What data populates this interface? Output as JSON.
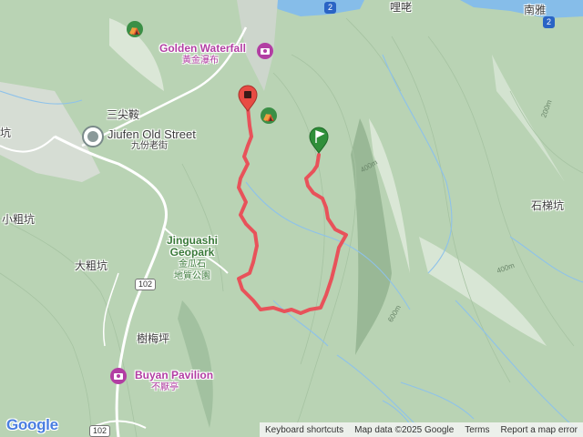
{
  "places": {
    "golden_waterfall": {
      "en": "Golden Waterfall",
      "zh": "黃金瀑布"
    },
    "jiufen": {
      "en": "Jiufen Old Street",
      "zh": "九份老街"
    },
    "jinguashi": {
      "en1": "Jinguashi",
      "en2": "Geopark",
      "zh1": "金瓜石",
      "zh2": "地質公園"
    },
    "buyan": {
      "en": "Buyan Pavilion",
      "zh": "不厭亭"
    },
    "towns": {
      "sanjianan": "三尖鞍",
      "liqi": "哩咾",
      "nanya": "南雅",
      "shitikeng": "石梯坑",
      "xiaozukeng": "小粗坑",
      "dazukeng": "大粗坑",
      "shumeiping": "樹梅坪",
      "keng": "坑"
    }
  },
  "roads": {
    "r102a": "102",
    "r102b": "102",
    "r2a": "2",
    "r2b": "2"
  },
  "contours": {
    "c400a": "400m",
    "c400b": "400m",
    "c200": "200m",
    "c600": "600m"
  },
  "icons": {
    "trail_start": "green-flag-icon",
    "trail_end": "red-pin-icon",
    "park": "park-icon",
    "attraction": "camera-icon",
    "landmark": "landmark-icon"
  },
  "colors": {
    "route": "#e8525a",
    "water": "#7fb6e6",
    "terrain": "#b9d3b4",
    "poi_purple": "#b23ea3",
    "park_green": "#3b7a3a"
  },
  "branding": {
    "logo": "Google"
  },
  "attribution": {
    "shortcuts": "Keyboard shortcuts",
    "mapdata": "Map data ©2025 Google",
    "terms": "Terms",
    "report": "Report a map error"
  }
}
